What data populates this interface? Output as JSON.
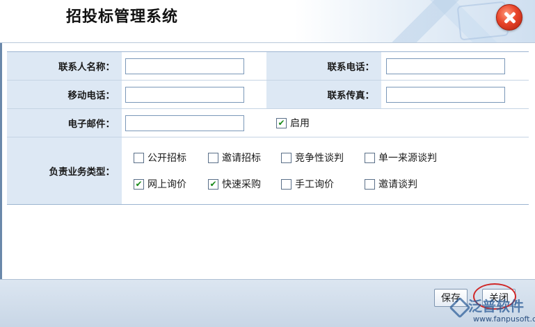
{
  "window": {
    "title": "招投标管理系统"
  },
  "form": {
    "contact_name": {
      "label": "联系人名称：",
      "value": ""
    },
    "contact_phone": {
      "label": "联系电话：",
      "value": ""
    },
    "mobile_phone": {
      "label": "移动电话：",
      "value": ""
    },
    "contact_fax": {
      "label": "联系传真：",
      "value": ""
    },
    "email": {
      "label": "电子邮件：",
      "value": ""
    },
    "enable": {
      "label": "启用",
      "checked": true
    },
    "business_types": {
      "label": "负责业务类型：",
      "options": [
        {
          "label": "公开招标",
          "checked": false
        },
        {
          "label": "邀请招标",
          "checked": false
        },
        {
          "label": "竞争性谈判",
          "checked": false
        },
        {
          "label": "单一来源谈判",
          "checked": false
        },
        {
          "label": "网上询价",
          "checked": true
        },
        {
          "label": "快速采购",
          "checked": true
        },
        {
          "label": "手工询价",
          "checked": false
        },
        {
          "label": "邀请谈判",
          "checked": false
        }
      ]
    }
  },
  "footer": {
    "save_label": "保存",
    "close_label": "关闭",
    "watermark_text": "泛普软件",
    "watermark_url": "www.fanpusoft.com"
  },
  "colors": {
    "label_bg": "#dde8f4",
    "border": "#9bb4d0",
    "check": "#1a8a1a",
    "close_button": "#e8452a",
    "annotation_circle": "#d02828"
  },
  "icons": {
    "close": "close-x-icon",
    "checkbox_checked": "check-icon"
  }
}
